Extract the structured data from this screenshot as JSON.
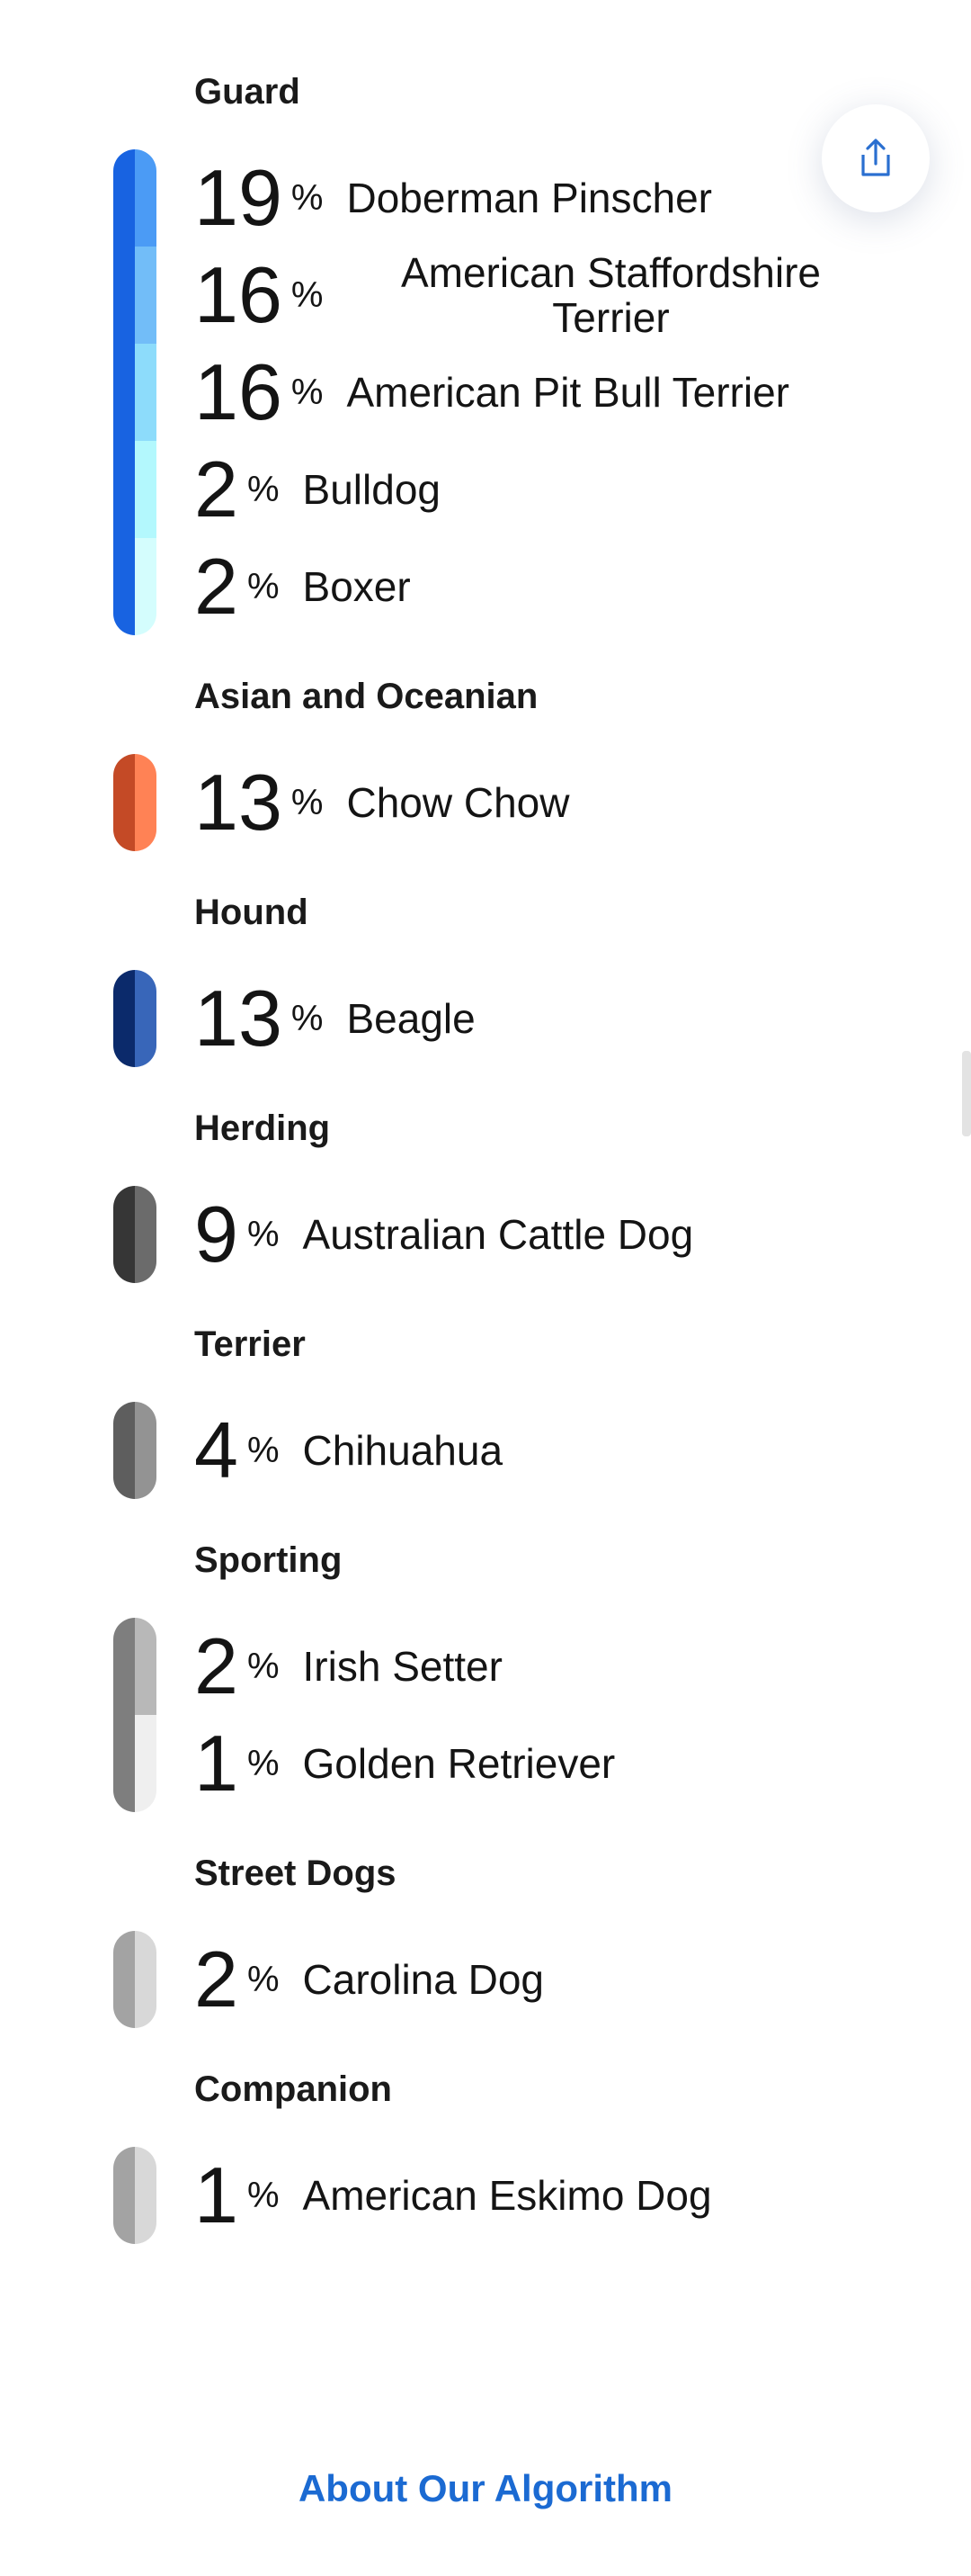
{
  "share": {
    "icon": "share-icon"
  },
  "footer": {
    "about_label": "About Our Algorithm"
  },
  "groups": [
    {
      "title": "Guard",
      "bar_color": "#1863e1",
      "items": [
        {
          "value": "19",
          "unit": "%",
          "breed": "Doberman Pinscher",
          "color": "#4b9bf5"
        },
        {
          "value": "16",
          "unit": "%",
          "breed": "American Staffordshire Terrier",
          "color": "#72bdf8"
        },
        {
          "value": "16",
          "unit": "%",
          "breed": "American Pit Bull Terrier",
          "color": "#8ddcfb"
        },
        {
          "value": "2",
          "unit": "%",
          "breed": "Bulldog",
          "color": "#b3f8fd"
        },
        {
          "value": "2",
          "unit": "%",
          "breed": "Boxer",
          "color": "#d4fdfd"
        }
      ]
    },
    {
      "title": "Asian and Oceanian",
      "bar_color": "#c44a26",
      "items": [
        {
          "value": "13",
          "unit": "%",
          "breed": "Chow Chow",
          "color": "#ff8255"
        }
      ]
    },
    {
      "title": "Hound",
      "bar_color": "#0b2a6b",
      "items": [
        {
          "value": "13",
          "unit": "%",
          "breed": "Beagle",
          "color": "#3866b9"
        }
      ]
    },
    {
      "title": "Herding",
      "bar_color": "#363636",
      "items": [
        {
          "value": "9",
          "unit": "%",
          "breed": "Australian Cattle Dog",
          "color": "#6b6b6b"
        }
      ]
    },
    {
      "title": "Terrier",
      "bar_color": "#5e5e5e",
      "items": [
        {
          "value": "4",
          "unit": "%",
          "breed": "Chihuahua",
          "color": "#939393"
        }
      ]
    },
    {
      "title": "Sporting",
      "bar_color": "#7e7e7e",
      "items": [
        {
          "value": "2",
          "unit": "%",
          "breed": "Irish Setter",
          "color": "#b8b8b8"
        },
        {
          "value": "1",
          "unit": "%",
          "breed": "Golden Retriever",
          "color": "#efefef"
        }
      ]
    },
    {
      "title": "Street Dogs",
      "bar_color": "#a3a3a3",
      "items": [
        {
          "value": "2",
          "unit": "%",
          "breed": "Carolina Dog",
          "color": "#d8d8d8"
        }
      ]
    },
    {
      "title": "Companion",
      "bar_color": "#a3a3a3",
      "items": [
        {
          "value": "1",
          "unit": "%",
          "breed": "American Eskimo Dog",
          "color": "#d8d8d8"
        }
      ]
    }
  ]
}
